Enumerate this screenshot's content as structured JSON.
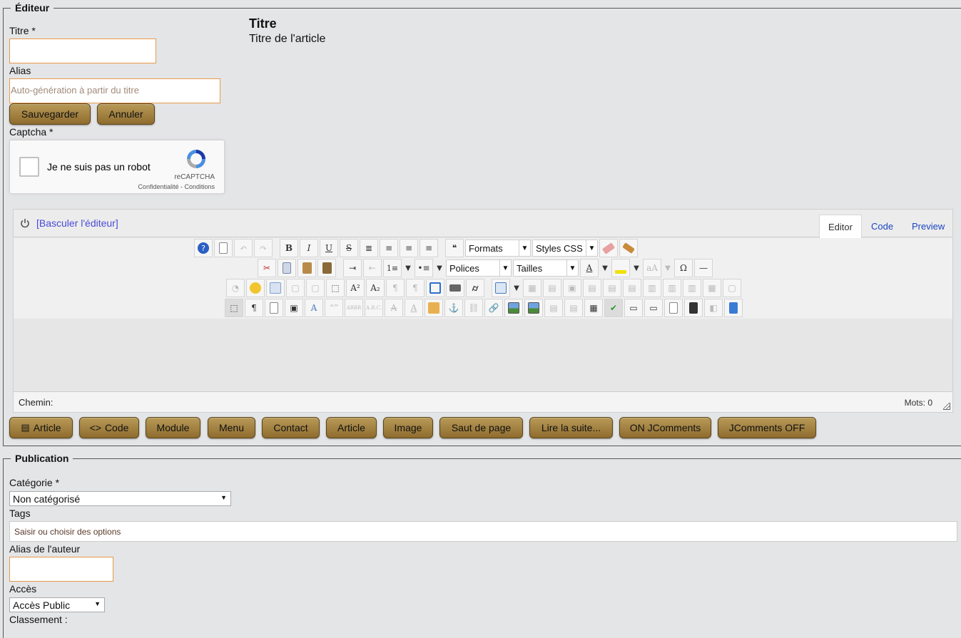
{
  "editor": {
    "legend": "Éditeur",
    "title_label": "Titre *",
    "title_value": "",
    "alias_label": "Alias",
    "alias_placeholder": "Auto-génération à partir du titre",
    "save_label": "Sauvegarder",
    "cancel_label": "Annuler",
    "captcha_label": "Captcha *",
    "captcha": {
      "checkbox_text": "Je ne suis pas un robot",
      "brand": "reCAPTCHA",
      "links": "Confidentialité - Conditions"
    },
    "help": {
      "heading": "Titre",
      "text": "Titre de l'article"
    },
    "toggle_label": "[Basculer l'éditeur]",
    "tabs": [
      {
        "label": "Editor",
        "active": true
      },
      {
        "label": "Code",
        "active": false
      },
      {
        "label": "Preview",
        "active": false
      }
    ],
    "toolbar": {
      "formats": "Formats",
      "styles": "Styles CSS",
      "fonts": "Polices",
      "sizes": "Tailles"
    },
    "status": {
      "path_label": "Chemin:",
      "words": "Mots: 0"
    },
    "insert_buttons": [
      "Article",
      "Code",
      "Module",
      "Menu",
      "Contact",
      "Article",
      "Image",
      "Saut de page",
      "Lire la suite...",
      "ON JComments",
      "JComments OFF"
    ]
  },
  "publication": {
    "legend": "Publication",
    "category_label": "Catégorie *",
    "category_value": "Non catégorisé",
    "tags_label": "Tags",
    "tags_placeholder": "Saisir ou choisir des options",
    "author_alias_label": "Alias de l'auteur",
    "author_alias_value": "",
    "access_label": "Accès",
    "access_value": "Accès Public",
    "ordering_label": "Classement :"
  },
  "colors": {
    "page_bg": "#e4e5e6",
    "button_gold": "#a68546",
    "input_border": "#e8994b",
    "link_blue": "#4a4ad8"
  }
}
